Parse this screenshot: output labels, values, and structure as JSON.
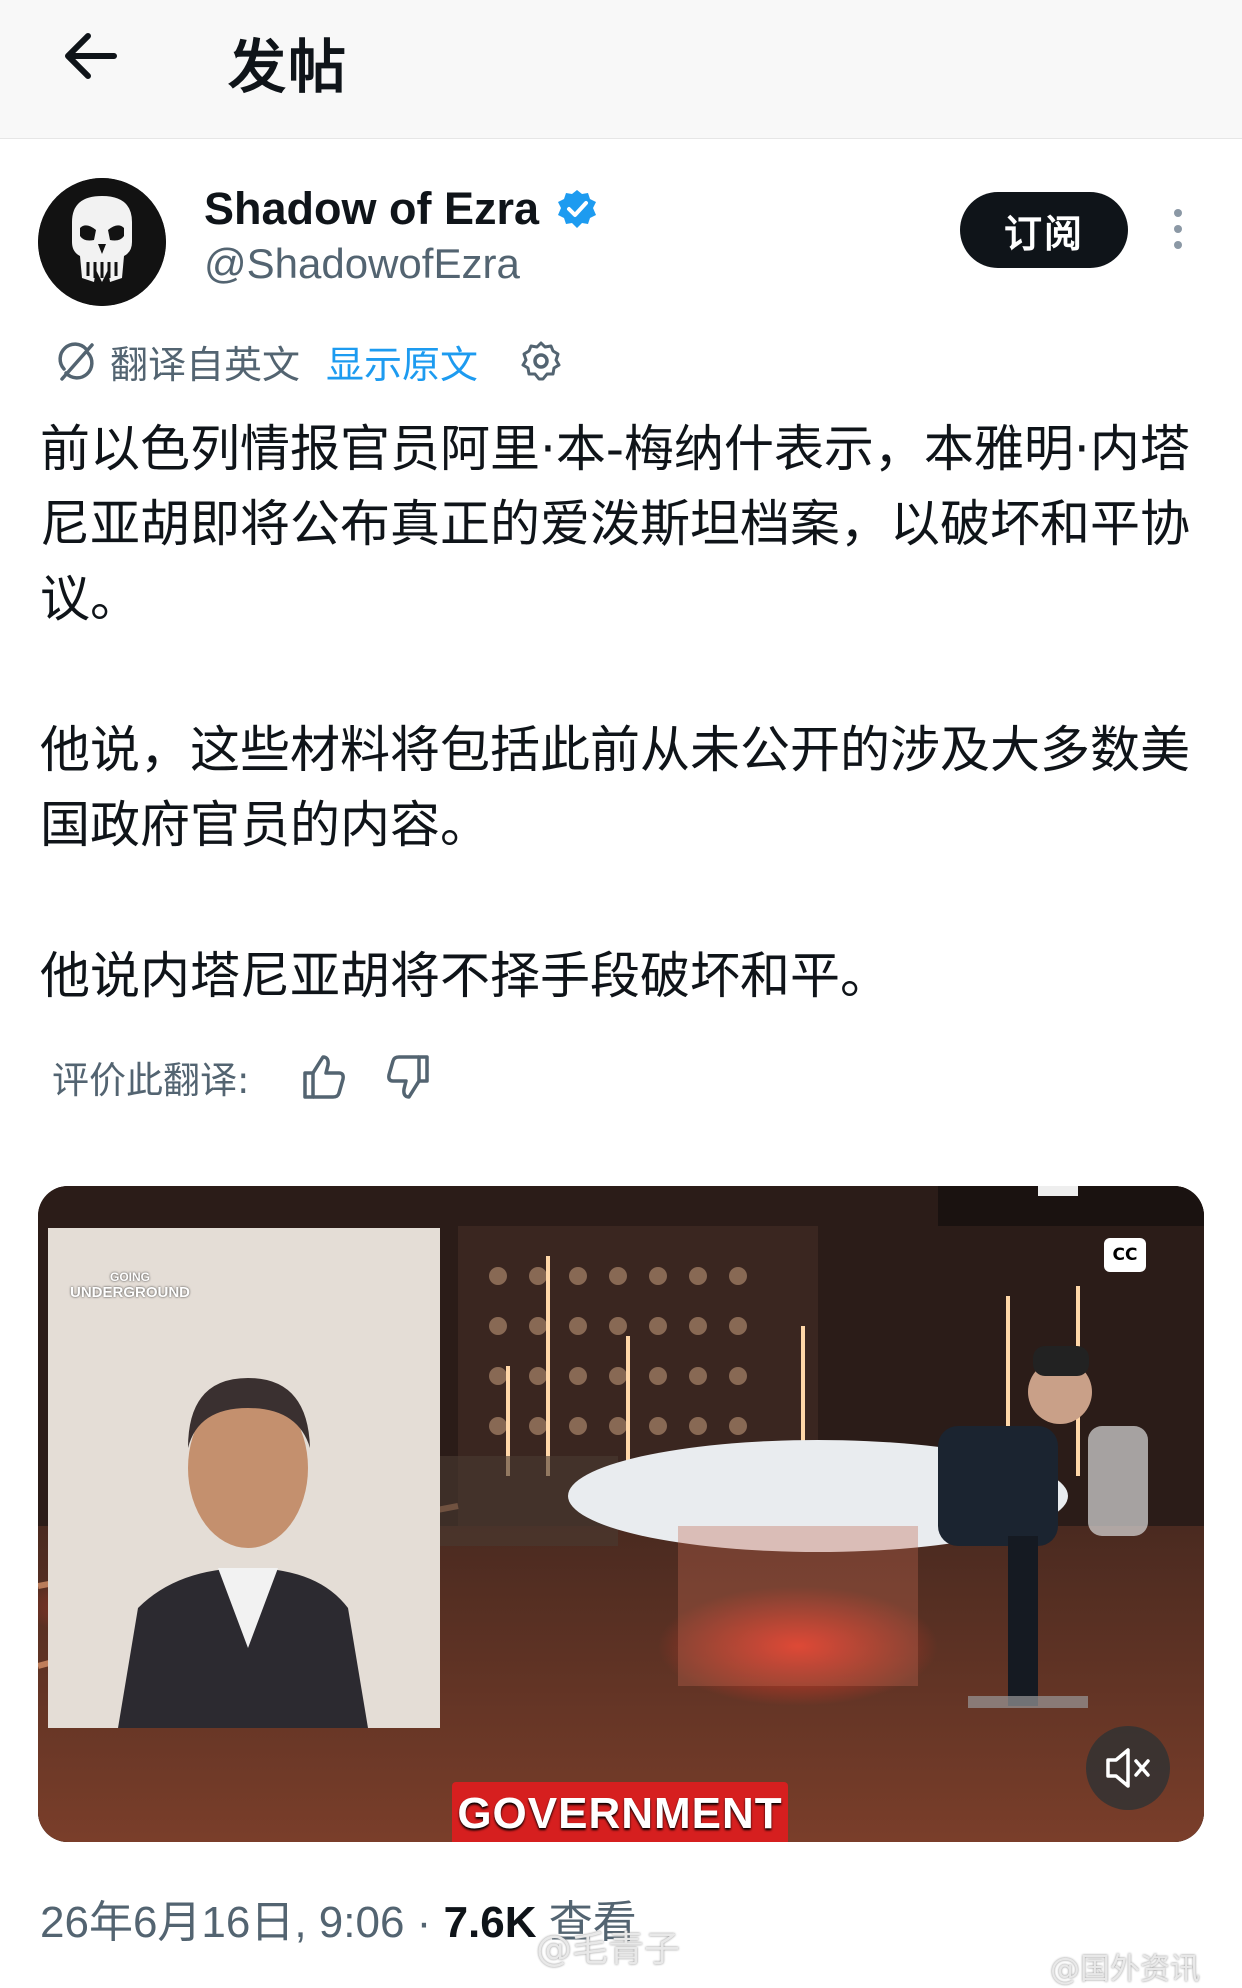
{
  "header": {
    "title": "发帖",
    "back_icon": "arrow-left-icon"
  },
  "post": {
    "author_name": "Shadow of Ezra",
    "author_handle": "@ShadowofEzra",
    "verified_icon": "verified-badge-icon",
    "subscribe_label": "订阅",
    "more_icon": "more-vertical-icon",
    "translation": {
      "translated_from": "翻译自英文",
      "show_original": "显示原文",
      "settings_icon": "gear-icon"
    },
    "paragraphs": [
      "前以色列情报官员阿里·本-梅纳什表示，本雅明·内塔尼亚胡即将公布真正的爱泼斯坦档案，以破坏和平协议。",
      "他说，这些材料将包括此前从未公开的涉及大多数美国政府官员的内容。",
      "他说内塔尼亚胡将不择手段破坏和平。"
    ],
    "rate_label": "评价此翻译:",
    "media": {
      "logo_text_line1": "GOING",
      "logo_text_line2": "UNDERGROUND",
      "cc_label": "CC",
      "caption": "GOVERNMENT",
      "mute_icon": "mute-speaker-icon"
    },
    "timestamp": "26年6月16日, 9:06",
    "separator": " · ",
    "views": "7.6K",
    "views_label": " 查看"
  },
  "watermark": "@毛青子",
  "watermark_corner": "@国外资讯"
}
